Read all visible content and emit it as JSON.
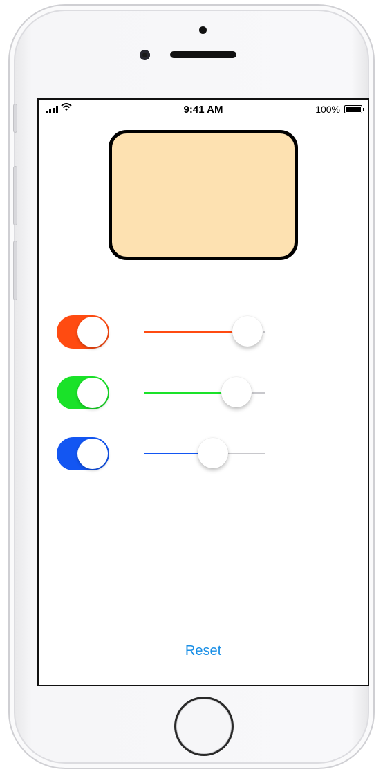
{
  "status_bar": {
    "time": "9:41 AM",
    "battery_percent": "100%",
    "battery_level": 1.0
  },
  "color_preview": {
    "fill": "#fde1b1",
    "border": "#000000"
  },
  "channels": [
    {
      "id": "red",
      "toggle_on": true,
      "color": "#ff4b11",
      "slider_value": 0.85
    },
    {
      "id": "green",
      "toggle_on": true,
      "color": "#1ae229",
      "slider_value": 0.76
    },
    {
      "id": "blue",
      "toggle_on": true,
      "color": "#1356f2",
      "slider_value": 0.57
    }
  ],
  "reset": {
    "label": "Reset",
    "color": "#1a8fe6"
  }
}
